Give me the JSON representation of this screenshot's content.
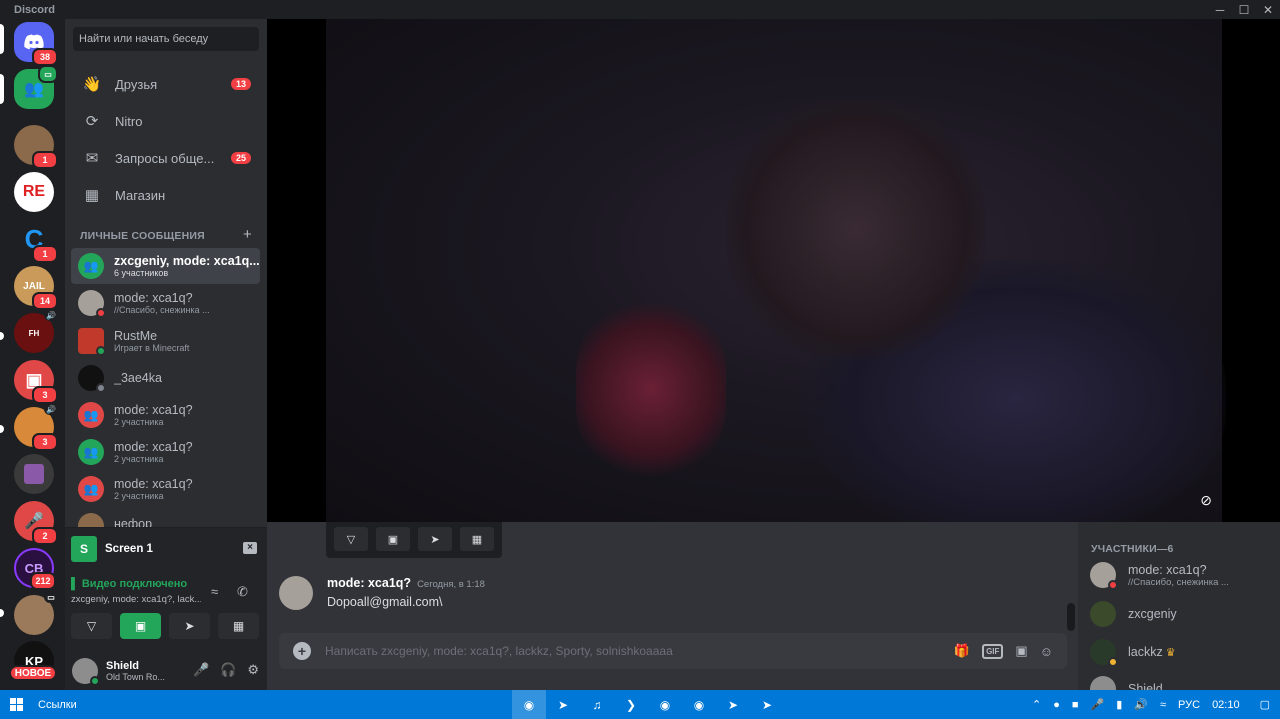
{
  "window": {
    "title": "Discord",
    "minimize": "─",
    "maximize": "☐",
    "close": "✕"
  },
  "guilds": [
    {
      "name": "home",
      "badge": "38"
    },
    {
      "name": "group",
      "badge": ""
    },
    {
      "name": "cat-server",
      "badge": "1"
    },
    {
      "name": "re-server",
      "label": "RE",
      "badge": ""
    },
    {
      "name": "c-server",
      "label": "C",
      "badge": "1"
    },
    {
      "name": "jail-server",
      "label": "JAIL",
      "badge": "14"
    },
    {
      "name": "fh-server",
      "label": "FH",
      "badge": ""
    },
    {
      "name": "bot-server",
      "badge": "3"
    },
    {
      "name": "anime-server",
      "badge": "3"
    },
    {
      "name": "pixel-server",
      "badge": ""
    },
    {
      "name": "mic-server",
      "badge": "2"
    },
    {
      "name": "cb-server",
      "label": "CB",
      "badge": "212"
    },
    {
      "name": "dog-server",
      "badge": ""
    },
    {
      "name": "kp-server",
      "label": "KP",
      "badge": ""
    }
  ],
  "new_badge": "НОВОЕ",
  "search": {
    "placeholder": "Найти или начать беседу"
  },
  "nav": [
    {
      "label": "Друзья",
      "badge": "13"
    },
    {
      "label": "Nitro",
      "badge": ""
    },
    {
      "label": "Запросы обще...",
      "badge": "25"
    },
    {
      "label": "Магазин",
      "badge": ""
    }
  ],
  "dm_header": "ЛИЧНЫЕ СООБЩЕНИЯ",
  "dm_add": "+",
  "dms": [
    {
      "name": "zxcgeniy, mode: xca1q...",
      "sub": "6 участников"
    },
    {
      "name": "mode: xca1q?",
      "sub": "//Спасибо, снежинка ..."
    },
    {
      "name": "RustMe",
      "sub": "Играет в Minecraft"
    },
    {
      "name": "_3ae4ka",
      "sub": ""
    },
    {
      "name": "mode: xca1q?",
      "sub": "2 участника"
    },
    {
      "name": "mode: xca1q?",
      "sub": "2 участника"
    },
    {
      "name": "mode: xca1q?",
      "sub": "2 участника"
    },
    {
      "name": "нефор",
      "sub": ""
    }
  ],
  "voice": {
    "stream_name": "Screen 1",
    "status": "Видео подключено",
    "channel": "zxcgeniy, mode: xca1q?, lack..."
  },
  "user": {
    "name": "Shield",
    "status": "Old Town Ro..."
  },
  "message": {
    "author": "mode: xca1q?",
    "time": "Сегодня, в 1:18",
    "text": "Dopoall@gmail.com\\"
  },
  "input": {
    "placeholder": "Написать zxcgeniy, mode: xca1q?, lackkz, Sporty, solnishkoaaaa",
    "gif": "GIF"
  },
  "members": {
    "title": "УЧАСТНИКИ—6",
    "list": [
      {
        "name": "mode: xca1q?",
        "sub": "//Спасибо, снежинка ..."
      },
      {
        "name": "zxcgeniy",
        "sub": ""
      },
      {
        "name": "lackkz",
        "sub": ""
      },
      {
        "name": "Shield",
        "sub": ""
      }
    ]
  },
  "taskbar": {
    "links": "Ссылки",
    "lang": "РУС",
    "time": "02:10"
  },
  "colors": {
    "accent": "#5865f2",
    "online": "#23a55a",
    "danger": "#f23f43",
    "taskbar": "#0078d7"
  }
}
